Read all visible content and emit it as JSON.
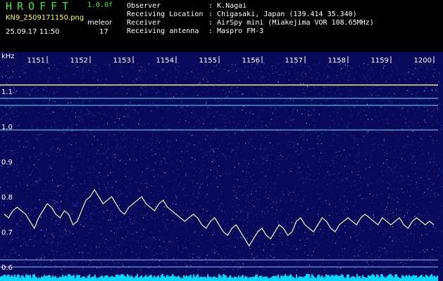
{
  "header": {
    "app_title": "HROFFT",
    "version": "1.0.0f",
    "file_name": "KN9_2509171150.png",
    "timestamp": "25.09.17 11:50",
    "meleor_label": "meleor",
    "meleor_count": "17",
    "info": [
      {
        "label": "Observer",
        "value": ": K.Nagai"
      },
      {
        "label": "Receiving Location",
        "value": ": Chigasaki, Japan (139.414 35.340)"
      },
      {
        "label": "Receiver",
        "value": ": AirSpy mini (Miakejima VOR 108.65MHz)"
      },
      {
        "label": "Receiving antenna",
        "value": ": Maspro FM-3"
      }
    ]
  },
  "colors": {
    "background": "#0a0a5a",
    "noise_dim": "#2a44c8",
    "noise_bright": "#6ec6ff",
    "trace": "#c8f0a0",
    "line": "#e8f080",
    "labels": "#ffffff",
    "bottom_band": "#00d8ff"
  },
  "chart_data": {
    "type": "heatmap",
    "title": "",
    "xlabel": "",
    "ylabel": "kHz",
    "x_ticks": [
      "1151",
      "1152",
      "1153",
      "1154",
      "1155",
      "1156",
      "1157",
      "1158",
      "1159",
      "1200"
    ],
    "xlim": [
      "1150",
      "1200"
    ],
    "y_ticks": [
      "1.1",
      "1.0",
      "0.9",
      "0.8",
      "0.7",
      "0.6"
    ],
    "ylim": [
      0.58,
      1.22
    ],
    "grid": false,
    "horizontal_lines_khz": [
      1.118,
      1.08,
      1.06,
      0.99,
      0.62,
      0.6
    ],
    "trace": {
      "x_minutes": [
        0,
        0.5,
        1,
        1.5,
        2,
        2.5,
        3,
        3.5,
        4,
        4.5,
        5,
        5.5,
        6,
        6.5,
        7,
        7.5,
        8,
        8.5,
        9,
        9.5,
        10,
        10.5,
        11,
        11.5,
        12,
        12.5,
        13,
        13.5,
        14,
        14.5,
        15,
        15.5,
        16,
        16.5,
        17,
        17.5,
        18,
        18.5,
        19,
        19.5,
        20,
        20.5,
        21,
        21.5,
        22,
        22.5,
        23,
        23.5,
        24,
        24.5,
        25,
        25.5,
        26,
        26.5,
        27,
        27.5,
        28,
        28.5,
        29,
        29.5,
        30,
        30.5,
        31,
        31.5,
        32,
        32.5,
        33,
        33.5,
        34,
        34.5,
        35,
        35.5,
        36,
        36.5,
        37,
        37.5,
        38,
        38.5,
        39,
        39.5,
        40,
        40.5,
        41,
        41.5,
        42,
        42.5,
        43,
        43.5,
        44,
        44.5,
        45,
        45.5,
        46,
        46.5,
        47,
        47.5,
        48,
        48.5,
        49,
        49.5,
        50
      ],
      "y_khz": [
        0.75,
        0.74,
        0.76,
        0.77,
        0.76,
        0.75,
        0.73,
        0.71,
        0.74,
        0.76,
        0.78,
        0.77,
        0.75,
        0.74,
        0.76,
        0.75,
        0.72,
        0.73,
        0.76,
        0.79,
        0.8,
        0.82,
        0.8,
        0.78,
        0.79,
        0.8,
        0.78,
        0.76,
        0.75,
        0.77,
        0.78,
        0.79,
        0.8,
        0.78,
        0.77,
        0.76,
        0.78,
        0.79,
        0.77,
        0.76,
        0.75,
        0.74,
        0.73,
        0.74,
        0.75,
        0.74,
        0.72,
        0.71,
        0.73,
        0.74,
        0.72,
        0.7,
        0.69,
        0.71,
        0.72,
        0.7,
        0.68,
        0.66,
        0.68,
        0.7,
        0.71,
        0.69,
        0.68,
        0.7,
        0.72,
        0.71,
        0.69,
        0.7,
        0.73,
        0.74,
        0.72,
        0.71,
        0.7,
        0.72,
        0.74,
        0.73,
        0.71,
        0.7,
        0.72,
        0.73,
        0.74,
        0.73,
        0.72,
        0.74,
        0.75,
        0.74,
        0.73,
        0.72,
        0.74,
        0.73,
        0.72,
        0.73,
        0.74,
        0.72,
        0.71,
        0.73,
        0.74,
        0.73,
        0.72,
        0.73,
        0.72
      ]
    }
  }
}
